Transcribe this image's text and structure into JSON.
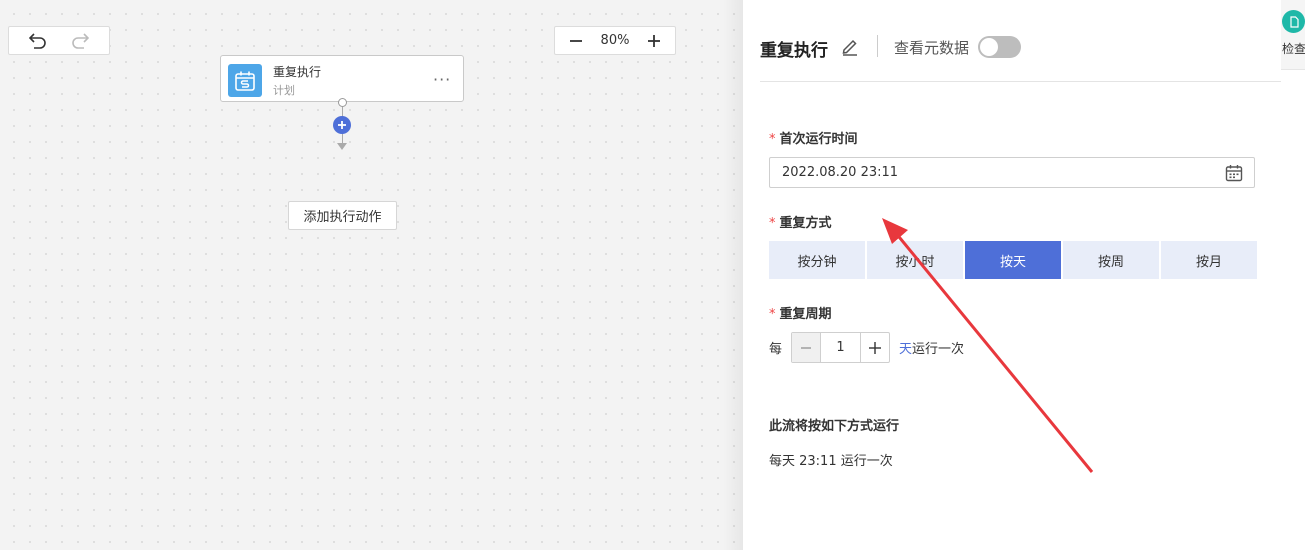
{
  "canvas": {
    "zoom_level": "80%",
    "node": {
      "title": "重复执行",
      "subtitle": "计划",
      "more_glyph": "···"
    },
    "add_action_label": "添加执行动作"
  },
  "panel": {
    "title": "重复执行",
    "view_metadata_label": "查看元数据",
    "view_metadata_on": false,
    "first_run_label": "首次运行时间",
    "required_mark": "*",
    "first_run_value": "2022.08.20 23:11",
    "repeat_mode_label": "重复方式",
    "repeat_modes": [
      "按分钟",
      "按小时",
      "按天",
      "按周",
      "按月"
    ],
    "selected_mode": "按天",
    "repeat_period_label": "重复周期",
    "period_prefix": "每",
    "period_value": "1",
    "period_unit": "天",
    "period_suffix": "运行一次",
    "summary_title": "此流将按如下方式运行",
    "summary_text": "每天 23:11 运行一次"
  },
  "side_strip": {
    "check_label": "检查"
  },
  "colors": {
    "accent": "#4e6fd8",
    "segment_bg": "#e8edf9",
    "required": "#ee4444",
    "node_icon": "#4da6e8",
    "check_badge": "#1fb8a8",
    "annotation_arrow": "#e8383d"
  }
}
